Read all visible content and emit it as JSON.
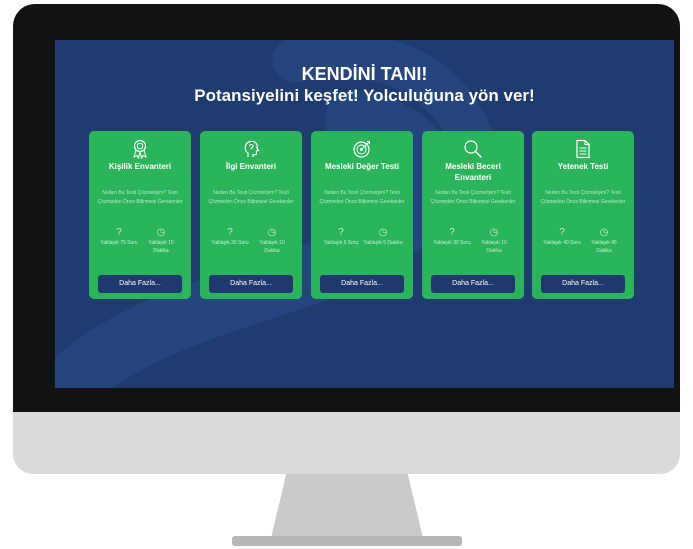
{
  "hero": {
    "title": "KENDİNİ TANI!",
    "subtitle": "Potansiyelini keşfet! Yolculuğuna yön ver!"
  },
  "colors": {
    "screen_bg": "#1f3b70",
    "card_bg": "#2bb55a",
    "button_bg": "#20386d",
    "text": "#ffffff"
  },
  "cards": [
    {
      "icon": "award-medal-icon",
      "title": "Kişilik Envanteri",
      "desc": "Neden Bu Testi Çözmeliyim? Testi Çözmeden Önce Bilinmesi Gerekenler",
      "questions": "Yaklaşık 75 Soru",
      "duration": "Yaklaşık 15 Dakika",
      "button": "Daha Fazla..."
    },
    {
      "icon": "head-profile-icon",
      "title": "İlgi Envanteri",
      "desc": "Neden Bu Testi Çözmeliyim? Testi Çözmeden Önce Bilinmesi Gerekenler",
      "questions": "Yaklaşık 30 Soru",
      "duration": "Yaklaşık 10 Dakika",
      "button": "Daha Fazla..."
    },
    {
      "icon": "target-icon",
      "title": "Mesleki Değer Testi",
      "desc": "Neden Bu Testi Çözmeliyim? Testi Çözmeden Önce Bilinmesi Gerekenler",
      "questions": "Yaklaşık 5 Soru",
      "duration": "Yaklaşık 5 Dakika",
      "button": "Daha Fazla..."
    },
    {
      "icon": "magnifier-icon",
      "title": "Mesleki Beceri Envanteri",
      "desc": "Neden Bu Testi Çözmeliyim? Testi Çözmeden Önce Bilinmesi Gerekenler",
      "questions": "Yaklaşık 30 Soru",
      "duration": "Yaklaşık 10 Dakika",
      "button": "Daha Fazla..."
    },
    {
      "icon": "document-icon",
      "title": "Yetenek Testi",
      "desc": "Neden Bu Testi Çözmeliyim? Testi Çözmeden Önce Bilinmesi Gerekenler",
      "questions": "Yaklaşık 40 Soru",
      "duration": "Yaklaşık 45 Dakika",
      "button": "Daha Fazla..."
    }
  ]
}
